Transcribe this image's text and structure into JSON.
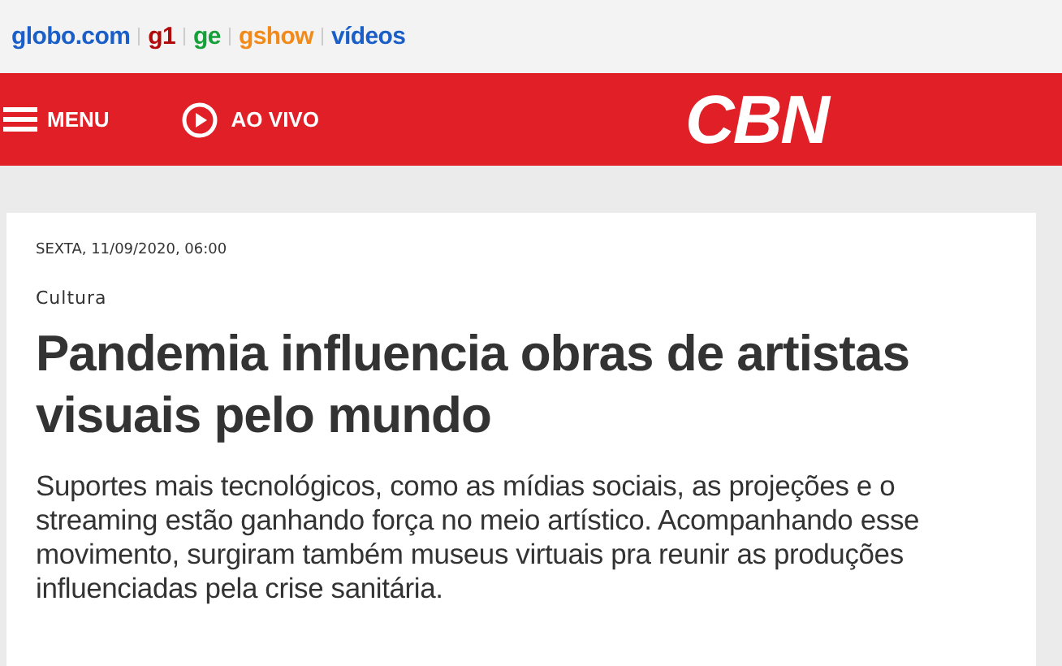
{
  "portal_links": [
    {
      "label": "globo.com",
      "color": "#1a5fc8"
    },
    {
      "label": "g1",
      "color": "#b00a0a"
    },
    {
      "label": "ge",
      "color": "#15a03a"
    },
    {
      "label": "gshow",
      "color": "#f28a1a"
    },
    {
      "label": "vídeos",
      "color": "#1a5fc8"
    }
  ],
  "nav": {
    "menu": "MENU",
    "live": "AO VIVO",
    "logo": "CBN"
  },
  "article": {
    "date": "SEXTA, 11/09/2020, 06:00",
    "section": "Cultura",
    "title": "Pandemia influencia obras de artistas visuais pelo mundo",
    "subtitle": "Suportes mais tecnológicos, como as mídias sociais, as projeções e o streaming estão ganhando força no meio artístico. Acompanhando esse movimento, surgiram também museus virtuais pra reunir as produções influenciadas pela crise sanitária."
  }
}
